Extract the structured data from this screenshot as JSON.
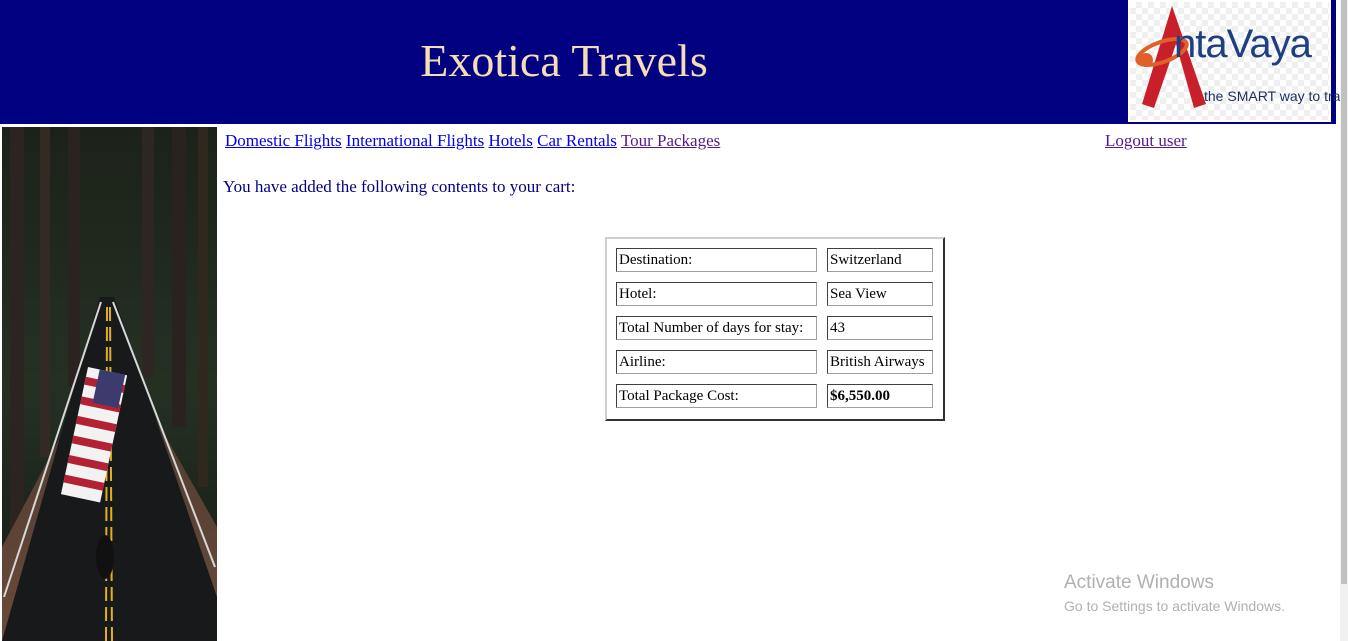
{
  "header": {
    "site_title": "Exotica Travels",
    "logo": {
      "brand": "ntaVaya",
      "tagline": "the SMART way to travel",
      "brand_color": "#1e3f82",
      "mark_color": "#c8202a"
    },
    "background_color": "#000080",
    "title_color": "#f5deb3"
  },
  "nav": {
    "links": [
      {
        "label": "Domestic Flights"
      },
      {
        "label": "International Flights"
      },
      {
        "label": "Hotels"
      },
      {
        "label": "Car Rentals"
      },
      {
        "label": "Tour Packages"
      }
    ],
    "logout_label": "Logout user"
  },
  "cart": {
    "message": "You have added the following contents to your cart:",
    "rows": [
      {
        "label": "Destination:",
        "value": "Switzerland"
      },
      {
        "label": "Hotel:",
        "value": "Sea View"
      },
      {
        "label": "Total Number of days for stay:",
        "value": "43"
      },
      {
        "label": "Airline:",
        "value": "British Airways"
      },
      {
        "label": "Total Package Cost:",
        "value": "$6,550.00"
      }
    ]
  },
  "sidebar": {
    "image_name": "road-with-american-flag-photo"
  },
  "watermark": {
    "title": "Activate Windows",
    "subtitle": "Go to Settings to activate Windows."
  }
}
